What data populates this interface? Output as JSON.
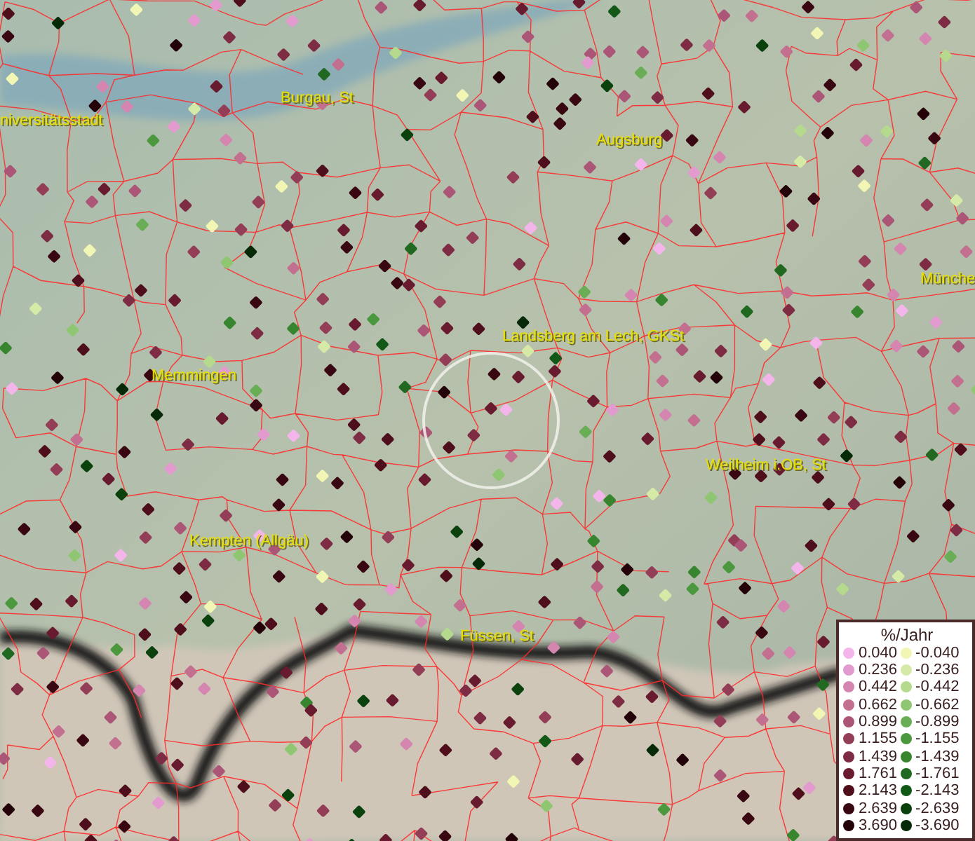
{
  "places": [
    {
      "name": "niversitätsstadt"
    },
    {
      "name": "Burgau, St"
    },
    {
      "name": "Augsburg"
    },
    {
      "name": "Münche"
    },
    {
      "name": "Landsberg am Lech, GKSt"
    },
    {
      "name": "Memmingen"
    },
    {
      "name": "Weilheim i.OB, St"
    },
    {
      "name": "Kempten (Allgäu)"
    },
    {
      "name": "Füssen, St"
    }
  ],
  "legend": {
    "title": "%/Jahr",
    "increase": [
      {
        "label": "0.040",
        "color": "#f4b6ea"
      },
      {
        "label": "0.236",
        "color": "#e39bcf"
      },
      {
        "label": "0.442",
        "color": "#d486b0"
      },
      {
        "label": "0.662",
        "color": "#c26f90"
      },
      {
        "label": "0.899",
        "color": "#ab5676"
      },
      {
        "label": "1.155",
        "color": "#933d57"
      },
      {
        "label": "1.439",
        "color": "#7e2b44"
      },
      {
        "label": "1.761",
        "color": "#681b2f"
      },
      {
        "label": "2.143",
        "color": "#4e0e1c"
      },
      {
        "label": "2.639",
        "color": "#380711"
      },
      {
        "label": "3.690",
        "color": "#230308"
      }
    ],
    "decrease": [
      {
        "label": "-0.040",
        "color": "#f2f6b4"
      },
      {
        "label": "-0.236",
        "color": "#d6eaa8"
      },
      {
        "label": "-0.442",
        "color": "#b6da8d"
      },
      {
        "label": "-0.662",
        "color": "#8fc671"
      },
      {
        "label": "-0.899",
        "color": "#69ad55"
      },
      {
        "label": "-1.155",
        "color": "#4c983e"
      },
      {
        "label": "-1.439",
        "color": "#38852f"
      },
      {
        "label": "-1.761",
        "color": "#216920"
      },
      {
        "label": "-2.143",
        "color": "#125816"
      },
      {
        "label": "-2.639",
        "color": "#0a410d"
      },
      {
        "label": "-3.690",
        "color": "#062908"
      }
    ]
  }
}
